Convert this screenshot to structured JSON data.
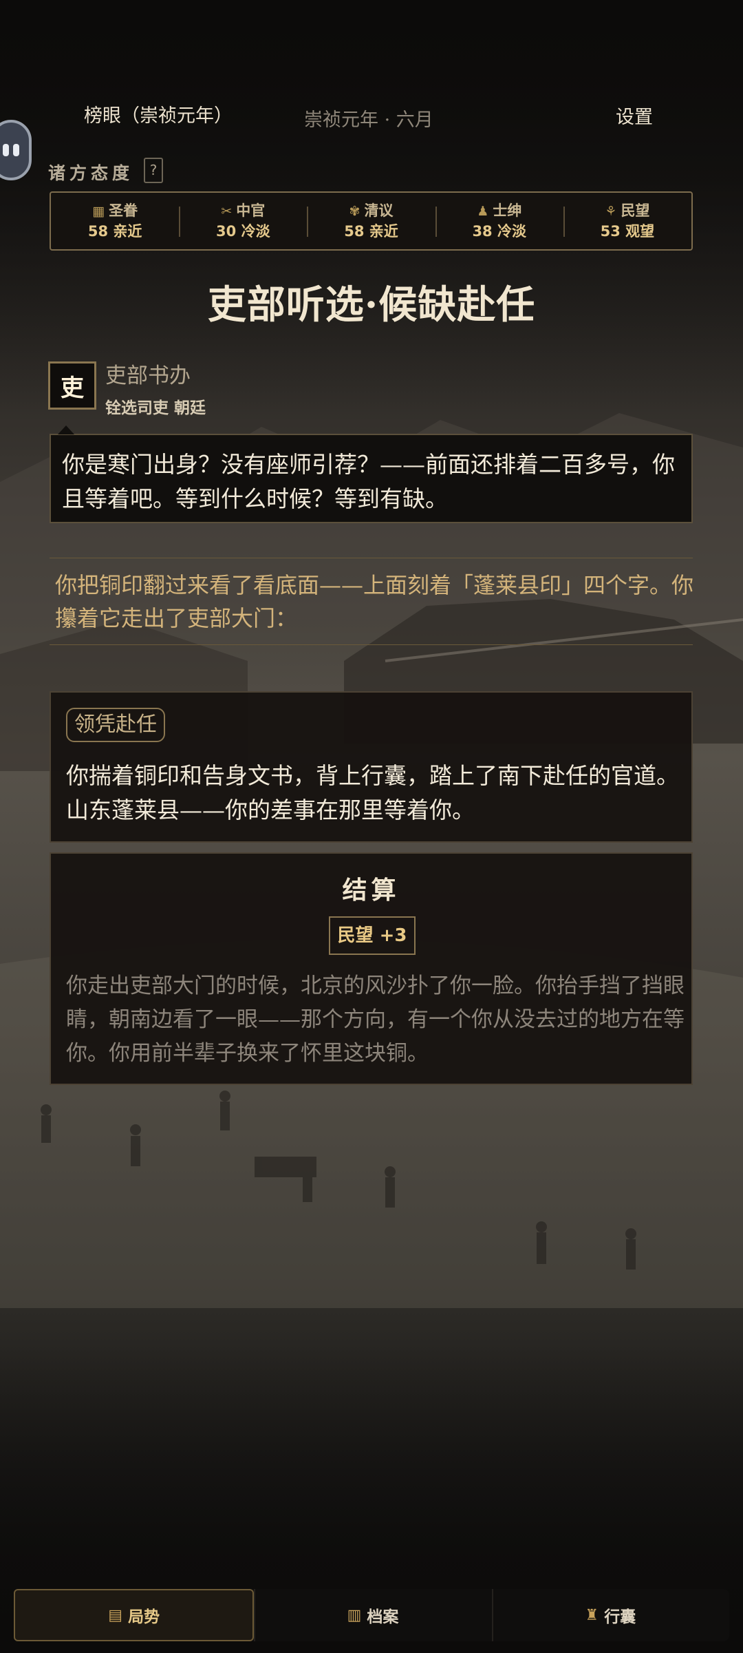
{
  "header": {
    "title": "榜眼（崇祯元年）",
    "date": "崇祯元年 · 六月",
    "settings_label": "设置"
  },
  "attitudes": {
    "label": "诸方态度",
    "help_label": "?",
    "items": [
      {
        "icon": "scroll-icon",
        "glyph": "▦",
        "name": "圣眷",
        "value": "58 亲近"
      },
      {
        "icon": "eunuch-icon",
        "glyph": "✂",
        "name": "中官",
        "value": "30 冷淡"
      },
      {
        "icon": "feather-icon",
        "glyph": "✾",
        "name": "清议",
        "value": "58 亲近"
      },
      {
        "icon": "gentry-icon",
        "glyph": "♟",
        "name": "士绅",
        "value": "38 冷淡"
      },
      {
        "icon": "people-icon",
        "glyph": "⚘",
        "name": "民望",
        "value": "53 观望"
      }
    ]
  },
  "event": {
    "title": "吏部听选·候缺赴任",
    "speaker": {
      "badge": "吏",
      "name": "吏部书办",
      "role": "铨选司吏 朝廷"
    },
    "speech": "你是寒门出身？没有座师引荐？——前面还排着二百多号，你且等着吧。等到什么时候？等到有缺。",
    "narration": "你把铜印翻过来看了看底面——上面刻着「蓬莱县印」四个字。你攥着它走出了吏部大门：",
    "choice": {
      "tag": "领凭赴任",
      "text": "你揣着铜印和告身文书，背上行囊，踏上了南下赴任的官道。山东蓬莱县——你的差事在那里等着你。"
    },
    "result": {
      "title": "结算",
      "effect": "民望 +3",
      "text": "你走出吏部大门的时候，北京的风沙扑了你一脸。你抬手挡了挡眼睛，朝南边看了一眼——那个方向，有一个你从没去过的地方在等你。你用前半辈子换来了怀里这块铜。"
    }
  },
  "nav": {
    "items": [
      {
        "icon": "situation-icon",
        "glyph": "▤",
        "label": "局势",
        "active": true
      },
      {
        "icon": "archive-icon",
        "glyph": "▥",
        "label": "档案",
        "active": false
      },
      {
        "icon": "bag-icon",
        "glyph": "♜",
        "label": "行囊",
        "active": false
      }
    ]
  },
  "colors": {
    "accent_gold": "#e5c98c",
    "panel_border": "#7d6c4d",
    "narration": "#d4b47b"
  }
}
